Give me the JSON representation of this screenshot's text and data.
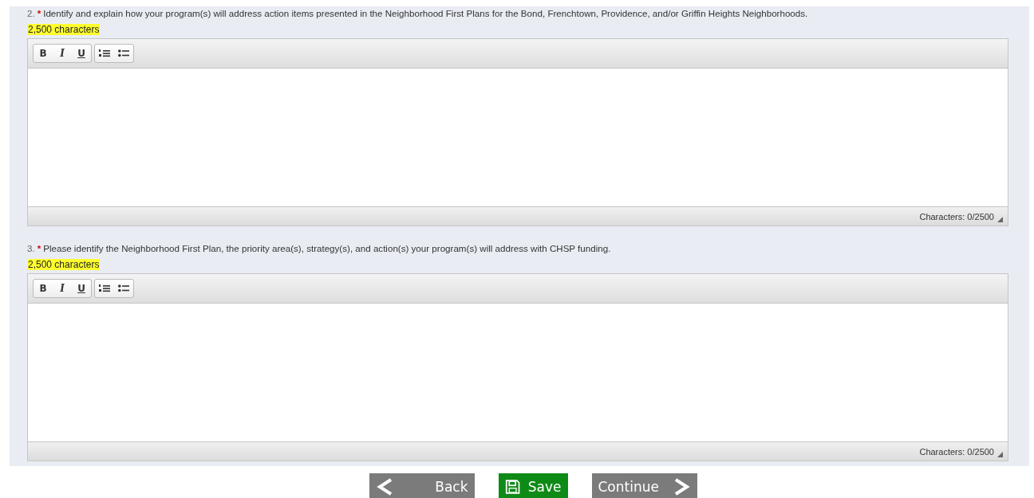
{
  "questions": [
    {
      "number": "2.",
      "required_mark": "*",
      "text": "Identify and explain how your program(s) will address action items presented in the Neighborhood First Plans for the Bond, Frenchtown, Providence, and/or Griffin Heights Neighborhoods.",
      "limit_note": "2,500 characters",
      "toolbar": [
        "B",
        "I",
        "U"
      ],
      "counter": "Characters: 0/2500"
    },
    {
      "number": "3.",
      "required_mark": "*",
      "text": "Please identify the Neighborhood First Plan, the priority area(s), strategy(s), and action(s) your program(s) will address with CHSP funding.",
      "limit_note": "2,500 characters",
      "toolbar": [
        "B",
        "I",
        "U"
      ],
      "counter": "Characters: 0/2500"
    }
  ],
  "buttons": [
    {
      "kind": "back",
      "label": "Back"
    },
    {
      "kind": "save",
      "label": "Save"
    },
    {
      "kind": "continue",
      "label": "Continue"
    }
  ]
}
